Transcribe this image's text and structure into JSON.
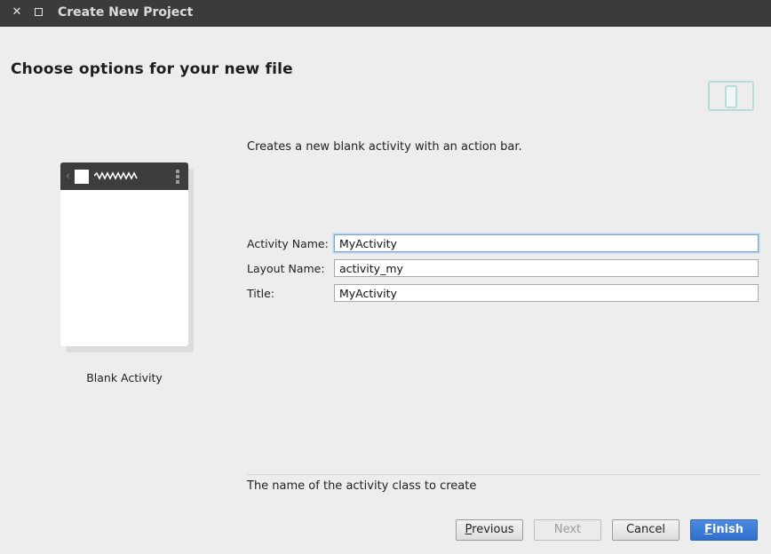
{
  "window": {
    "title": "Create New Project"
  },
  "header": {
    "heading": "Choose options for your new file"
  },
  "template": {
    "name": "Blank Activity",
    "description": "Creates a new blank activity with an action bar."
  },
  "form": {
    "activity_name": {
      "label": "Activity Name:",
      "value": "MyActivity"
    },
    "layout_name": {
      "label": "Layout Name:",
      "value": "activity_my"
    },
    "title": {
      "label": "Title:",
      "value": "MyActivity"
    }
  },
  "hint": "The name of the activity class to create",
  "buttons": {
    "previous_first": "P",
    "previous_rest": "revious",
    "next": "Next",
    "cancel": "Cancel",
    "finish_first": "F",
    "finish_rest": "inish"
  },
  "colors": {
    "accent": "#2f6fcd",
    "titlebar": "#3b3b3b",
    "background": "#ededed"
  }
}
